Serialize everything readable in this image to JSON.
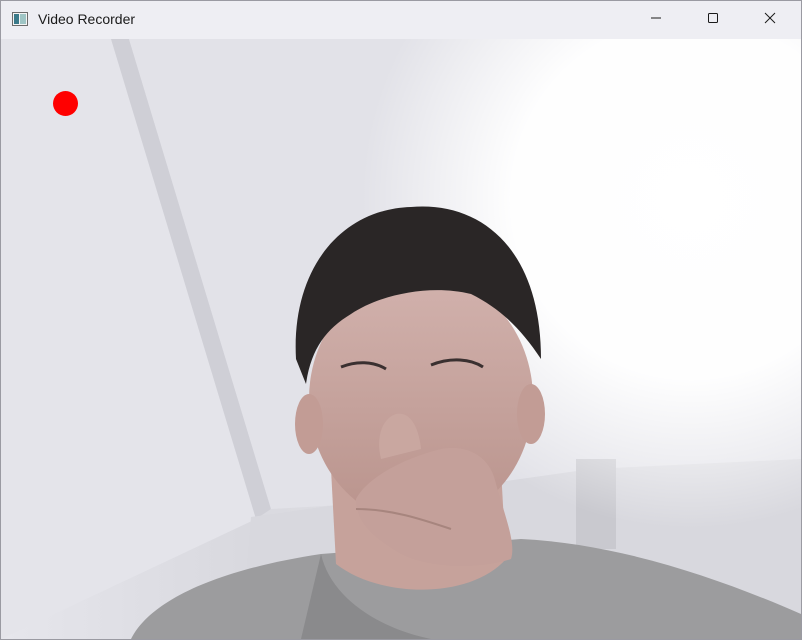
{
  "window": {
    "title": "Video Recorder",
    "icon": "video-app-icon"
  },
  "caption_buttons": {
    "minimize": "minimize-icon",
    "maximize": "maximize-icon",
    "close": "close-icon"
  },
  "video": {
    "recording_indicator_color": "#ff0000",
    "recording": true
  }
}
